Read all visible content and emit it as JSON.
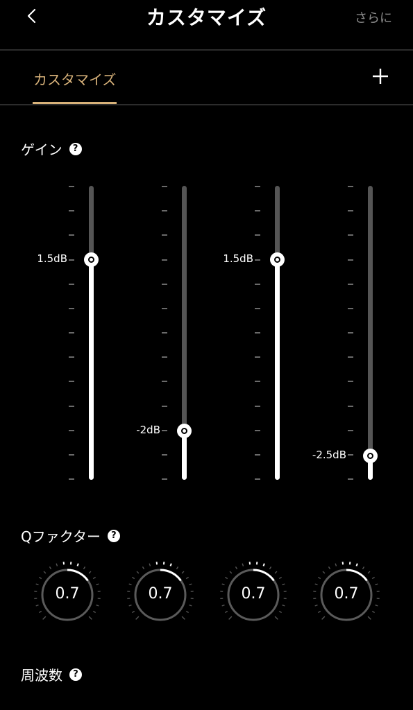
{
  "header": {
    "title": "カスタマイズ",
    "more_label": "さらに"
  },
  "tabs": {
    "active_label": "カスタマイズ"
  },
  "sections": {
    "gain_label": "ゲイン",
    "q_label": "Qファクター",
    "freq_label": "周波数",
    "help_glyph": "?"
  },
  "gain": {
    "levels": [
      0.75,
      0.167,
      0.75,
      0.083
    ],
    "labels": [
      "1.5dB",
      "-2dB",
      "1.5dB",
      "-2.5dB"
    ]
  },
  "q_factor": {
    "values": [
      "0.7",
      "0.7",
      "0.7",
      "0.7"
    ]
  },
  "colors": {
    "accent": "#d8b27a",
    "track": "#555555",
    "background": "#000000"
  },
  "icons": {
    "back": "chevron-left-icon",
    "add": "plus-icon",
    "help": "question-icon"
  }
}
